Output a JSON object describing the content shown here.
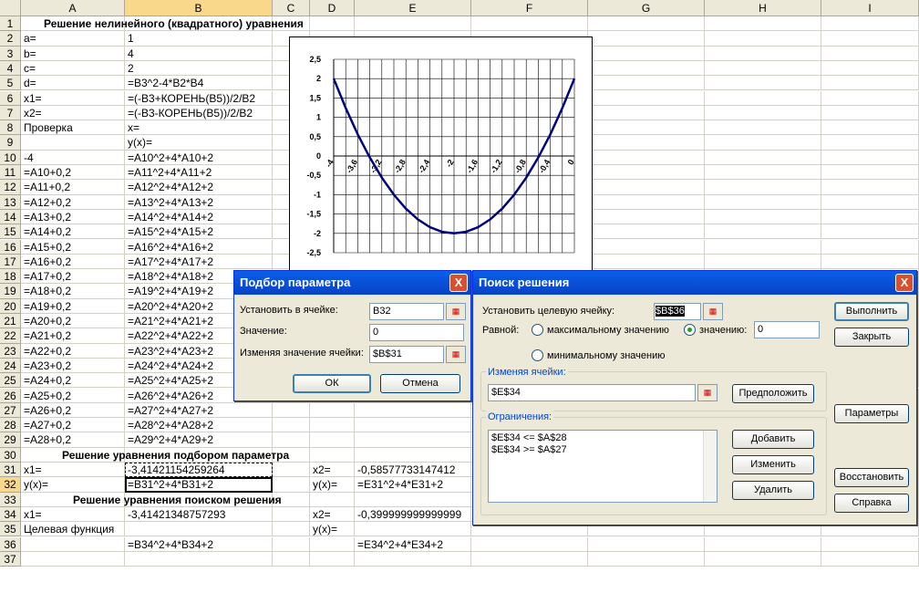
{
  "columns": [
    "A",
    "B",
    "C",
    "D",
    "E",
    "F",
    "G",
    "H",
    "I"
  ],
  "selected_column": "B",
  "selected_row": 32,
  "header_title": "Решение нелинейного (квадратного) уравнения",
  "rows": [
    {
      "r": 1,
      "a": "",
      "b": ""
    },
    {
      "r": 2,
      "a": "a=",
      "b": "1"
    },
    {
      "r": 3,
      "a": "b=",
      "b": "4"
    },
    {
      "r": 4,
      "a": "c=",
      "b": "2"
    },
    {
      "r": 5,
      "a": "d=",
      "b": "=B3^2-4*B2*B4"
    },
    {
      "r": 6,
      "a": "x1=",
      "b": "=(-B3+КОРЕНЬ(B5))/2/B2"
    },
    {
      "r": 7,
      "a": "x2=",
      "b": "=(-B3-КОРЕНЬ(B5))/2/B2"
    },
    {
      "r": 8,
      "a": "Проверка",
      "b": "x="
    },
    {
      "r": 9,
      "a": "",
      "b": "y(x)="
    },
    {
      "r": 10,
      "a": "-4",
      "b": "=A10^2+4*A10+2"
    },
    {
      "r": 11,
      "a": "=A10+0,2",
      "b": "=A11^2+4*A11+2"
    },
    {
      "r": 12,
      "a": "=A11+0,2",
      "b": "=A12^2+4*A12+2"
    },
    {
      "r": 13,
      "a": "=A12+0,2",
      "b": "=A13^2+4*A13+2"
    },
    {
      "r": 14,
      "a": "=A13+0,2",
      "b": "=A14^2+4*A14+2"
    },
    {
      "r": 15,
      "a": "=A14+0,2",
      "b": "=A15^2+4*A15+2"
    },
    {
      "r": 16,
      "a": "=A15+0,2",
      "b": "=A16^2+4*A16+2"
    },
    {
      "r": 17,
      "a": "=A16+0,2",
      "b": "=A17^2+4*A17+2"
    },
    {
      "r": 18,
      "a": "=A17+0,2",
      "b": "=A18^2+4*A18+2"
    },
    {
      "r": 19,
      "a": "=A18+0,2",
      "b": "=A19^2+4*A19+2"
    },
    {
      "r": 20,
      "a": "=A19+0,2",
      "b": "=A20^2+4*A20+2"
    },
    {
      "r": 21,
      "a": "=A20+0,2",
      "b": "=A21^2+4*A21+2"
    },
    {
      "r": 22,
      "a": "=A21+0,2",
      "b": "=A22^2+4*A22+2"
    },
    {
      "r": 23,
      "a": "=A22+0,2",
      "b": "=A23^2+4*A23+2"
    },
    {
      "r": 24,
      "a": "=A23+0,2",
      "b": "=A24^2+4*A24+2"
    },
    {
      "r": 25,
      "a": "=A24+0,2",
      "b": "=A25^2+4*A25+2"
    },
    {
      "r": 26,
      "a": "=A25+0,2",
      "b": "=A26^2+4*A26+2"
    },
    {
      "r": 27,
      "a": "=A26+0,2",
      "b": "=A27^2+4*A27+2"
    },
    {
      "r": 28,
      "a": "=A27+0,2",
      "b": "=A28^2+4*A28+2"
    },
    {
      "r": 29,
      "a": "=A28+0,2",
      "b": "=A29^2+4*A29+2"
    },
    {
      "r": 30,
      "a": "",
      "b": ""
    },
    {
      "r": 31,
      "a": "x1=",
      "b": "-3,41421154259264",
      "d": "x2=",
      "e": "-0,58577733147412"
    },
    {
      "r": 32,
      "a": "y(x)=",
      "b": "=B31^2+4*B31+2",
      "d": "y(x)=",
      "e": "=E31^2+4*E31+2"
    },
    {
      "r": 33,
      "a": "",
      "b": ""
    },
    {
      "r": 34,
      "a": "x1=",
      "b": "-3,41421348757293",
      "d": "x2=",
      "e": "-0,399999999999999"
    },
    {
      "r": 35,
      "a": "Целевая функция",
      "b": "",
      "d": "y(x)="
    },
    {
      "r": 36,
      "a": "",
      "b": "=B34^2+4*B34+2",
      "e": "=E34^2+4*E34+2"
    },
    {
      "r": 37,
      "a": "",
      "b": ""
    }
  ],
  "row30_title": "Решение уравнения подбором параметра",
  "row33_title": "Решение уравнения поиском решения",
  "chart_data": {
    "type": "line",
    "title": "",
    "x": [
      -4,
      -3.8,
      -3.6,
      -3.4,
      -3.2,
      -3,
      -2.8,
      -2.6,
      -2.4,
      -2.2,
      -2,
      -1.8,
      -1.6,
      -1.4,
      -1.2,
      -1,
      -0.8,
      -0.6,
      -0.4,
      -0.2,
      0
    ],
    "y": [
      2,
      1.24,
      0.56,
      -0.04,
      -0.56,
      -1,
      -1.36,
      -1.64,
      -1.84,
      -1.96,
      -2,
      -1.96,
      -1.84,
      -1.64,
      -1.36,
      -1,
      -0.56,
      -0.04,
      0.56,
      1.24,
      2
    ],
    "xlim": [
      -4,
      0
    ],
    "ylim": [
      -2.5,
      2.5
    ],
    "yticks": [
      "2,5",
      "2",
      "1,5",
      "1",
      "0,5",
      "0",
      "-0,5",
      "-1",
      "-1,5",
      "-2",
      "-2,5"
    ],
    "xticks": [
      "-4",
      "-3,6",
      "-3,2",
      "-2,8",
      "-2,4",
      "-2",
      "-1,6",
      "-1,2",
      "-0,8",
      "-0,4",
      "0"
    ],
    "grid": true,
    "line_color": "#000080"
  },
  "goal_seek": {
    "title": "Подбор параметра",
    "set_cell_label": "Установить в ячейке:",
    "set_cell_value": "B32",
    "value_label": "Значение:",
    "value_value": "0",
    "changing_label": "Изменяя значение ячейки:",
    "changing_value": "$B$31",
    "ok": "ОК",
    "cancel": "Отмена",
    "close": "X"
  },
  "solver": {
    "title": "Поиск решения",
    "target_label": "Установить целевую ячейку:",
    "target_value": "$B$36",
    "equal_label": "Равной:",
    "opt_max": "максимальному значению",
    "opt_value": "значению:",
    "opt_value_input": "0",
    "opt_min": "минимальному значению",
    "changing_label": "Изменяя ячейки:",
    "changing_value": "$E$34",
    "guess": "Предположить",
    "constraints_label": "Ограничения:",
    "constraints": [
      "$E$34 <= $A$28",
      "$E$34 >= $A$27"
    ],
    "add": "Добавить",
    "change": "Изменить",
    "delete": "Удалить",
    "run": "Выполнить",
    "close_btn": "Закрыть",
    "params": "Параметры",
    "restore": "Восстановить",
    "help": "Справка",
    "close": "X"
  }
}
